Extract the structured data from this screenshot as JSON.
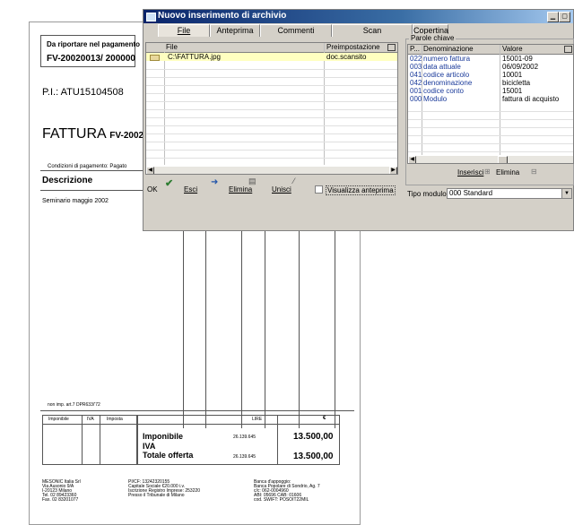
{
  "invoice": {
    "carry_label": "Da riportare nel pagamento",
    "carry_code": "FV-20020013/ 200000",
    "vat_id": "P.I.: ATU15104508",
    "fattura_word": "FATTURA",
    "fattura_number": "FV-20020013 /",
    "payment_conditions": "Condizioni di pagamento: Pagato",
    "description_header": "Descrizione",
    "line_item": "Seminario maggio 2002",
    "vat_note": "non imp. art.7 DPR633/'72",
    "vat_table": {
      "imponibile": "Imponibile",
      "iva": "IVA",
      "imposta": "Imposta"
    },
    "totals": {
      "currency_lire": "LIRE",
      "currency_euro": "€",
      "imponibile_label": "Imponibile",
      "iva_label": "IVA",
      "totale_label": "Totale offerta",
      "imponibile_lire": "26.139.645",
      "imponibile_euro": "13.500,00",
      "totale_lire": "26.139.645",
      "totale_euro": "13.500,00"
    },
    "footer": {
      "company": [
        "MESONIC Italia Srl",
        "Via Ausonio 9/A",
        "I-20123 Milano",
        "Tel. 02 89423360",
        "Fax. 02 83201077"
      ],
      "legal": [
        "PI/CF: 13242320155",
        "Capitale Sociale €20.000 i.v.",
        "Iscrizione Registro Imprese: 253220",
        "Presso il Tribunale di Milano"
      ],
      "bank": [
        "Banca d'appoggio:",
        "Banca Popolare di Sondrio, Ag. 7",
        "c/c: 062-0004960",
        "ABI: 05696    CAB: 01606",
        "cod. SWIFT: POSOIT22MIL"
      ]
    }
  },
  "window": {
    "title": "Nuovo inserimento di archivio",
    "tabs": [
      "File",
      "Anteprima",
      "Commenti",
      "Scan",
      "Copertina"
    ],
    "file_grid": {
      "columns": [
        "File",
        "Preimpostazione"
      ],
      "rows": [
        {
          "file": "C:\\FATTURA.jpg",
          "preset": "doc.scansito"
        }
      ]
    },
    "keywords": {
      "group_title": "Parole chiave",
      "columns": [
        "P...",
        "Denominazione",
        "Valore"
      ],
      "rows": [
        {
          "p": "022",
          "name": "numero fattura",
          "value": "15001-09"
        },
        {
          "p": "003",
          "name": "data attuale",
          "value": "06/09/2002"
        },
        {
          "p": "041",
          "name": "codice articolo",
          "value": "10001"
        },
        {
          "p": "042",
          "name": "denominazione",
          "value": "bicicletta"
        },
        {
          "p": "001",
          "name": "codice conto",
          "value": "15001"
        },
        {
          "p": "000",
          "name": "Modulo",
          "value": "fattura di acquisto"
        }
      ]
    },
    "buttons": {
      "ok": "OK",
      "esci": "Esci",
      "elimina": "Elimina",
      "unisci": "Unisci",
      "visualizza": "Visualizza anteprima",
      "inserisci": "Inserisci",
      "elimina_kw": "Elimina"
    },
    "tipo_modulo_label": "Tipo modulo:",
    "tipo_modulo_value": "000 Standard",
    "colors": {
      "title_start": "#0a246a",
      "title_end": "#a6caf0",
      "selected_row": "#ffffc0",
      "keyword_text": "#1a3a9a"
    }
  }
}
